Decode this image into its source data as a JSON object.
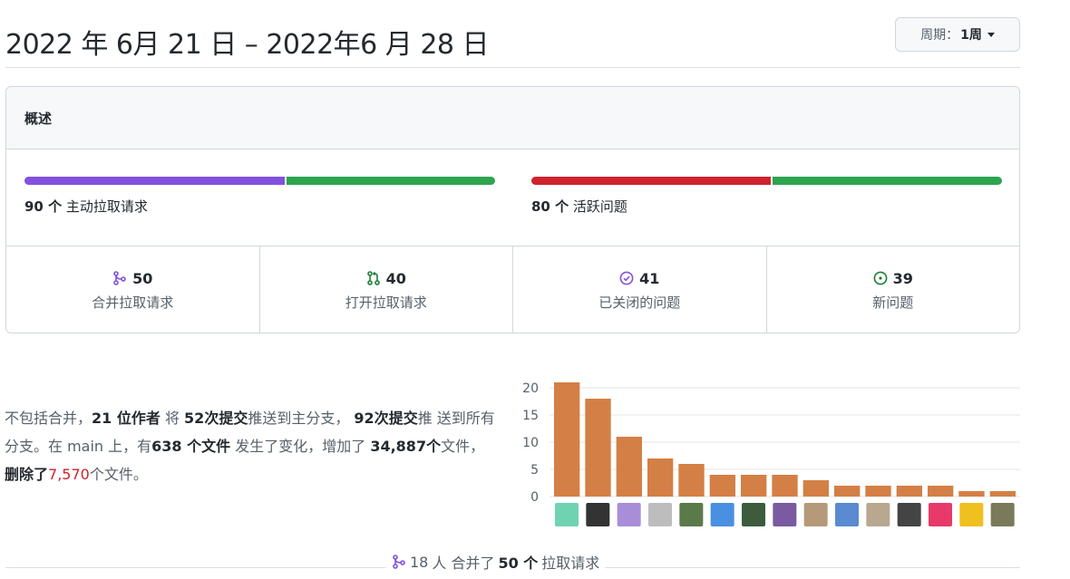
{
  "header": {
    "title": "2022 年 6月 21 日 – 2022年6 月 28 日",
    "period_label": "周期：",
    "period_value": "1周"
  },
  "overview": {
    "heading": "概述",
    "active_prs": {
      "count": "90 个",
      "label": " 主动拉取请求",
      "merged_fraction": 0.556
    },
    "active_issues": {
      "count": "80 个",
      "label": " 活跃问题",
      "closed_fraction": 0.51
    },
    "colors": {
      "purple": "#8250df",
      "green": "#2da44e",
      "red": "#cf222e"
    },
    "stats": [
      {
        "icon": "merge-icon",
        "value": "50",
        "label": "合并拉取请求"
      },
      {
        "icon": "pull-request-icon",
        "value": "40",
        "label": "打开拉取请求"
      },
      {
        "icon": "issue-closed-icon",
        "value": "41",
        "label": "已关闭的问题"
      },
      {
        "icon": "issue-open-icon",
        "value": "39",
        "label": "新问题"
      }
    ]
  },
  "summary": {
    "p1": "不包括合并，",
    "authors": "21 位作者",
    "p2": " 将 ",
    "commits_main": "52次提交",
    "p3": "推送到主分支， ",
    "commits_all": "92次提交",
    "p4": "推 送到所有分支。在 main 上，有",
    "files": "638 个文件",
    "p5": " 发生了变化，增加了 ",
    "additions": "34,887",
    "p6": "个",
    "p7": "文件， ",
    "deleted_label": "删除了",
    "deletions": "7,570",
    "p8": "个文件。"
  },
  "chart_data": {
    "type": "bar",
    "values": [
      21,
      18,
      11,
      7,
      6,
      4,
      4,
      4,
      3,
      2,
      2,
      2,
      2,
      1,
      1
    ],
    "ylim": [
      0,
      20
    ],
    "yticks": [
      "0",
      "5",
      "10",
      "15",
      "20"
    ],
    "bar_color": "#d47f45",
    "grid": true
  },
  "footer": {
    "count": "18",
    "t1": "人 合并了",
    "prs": "50 个",
    "t2": " 拉取请求"
  }
}
